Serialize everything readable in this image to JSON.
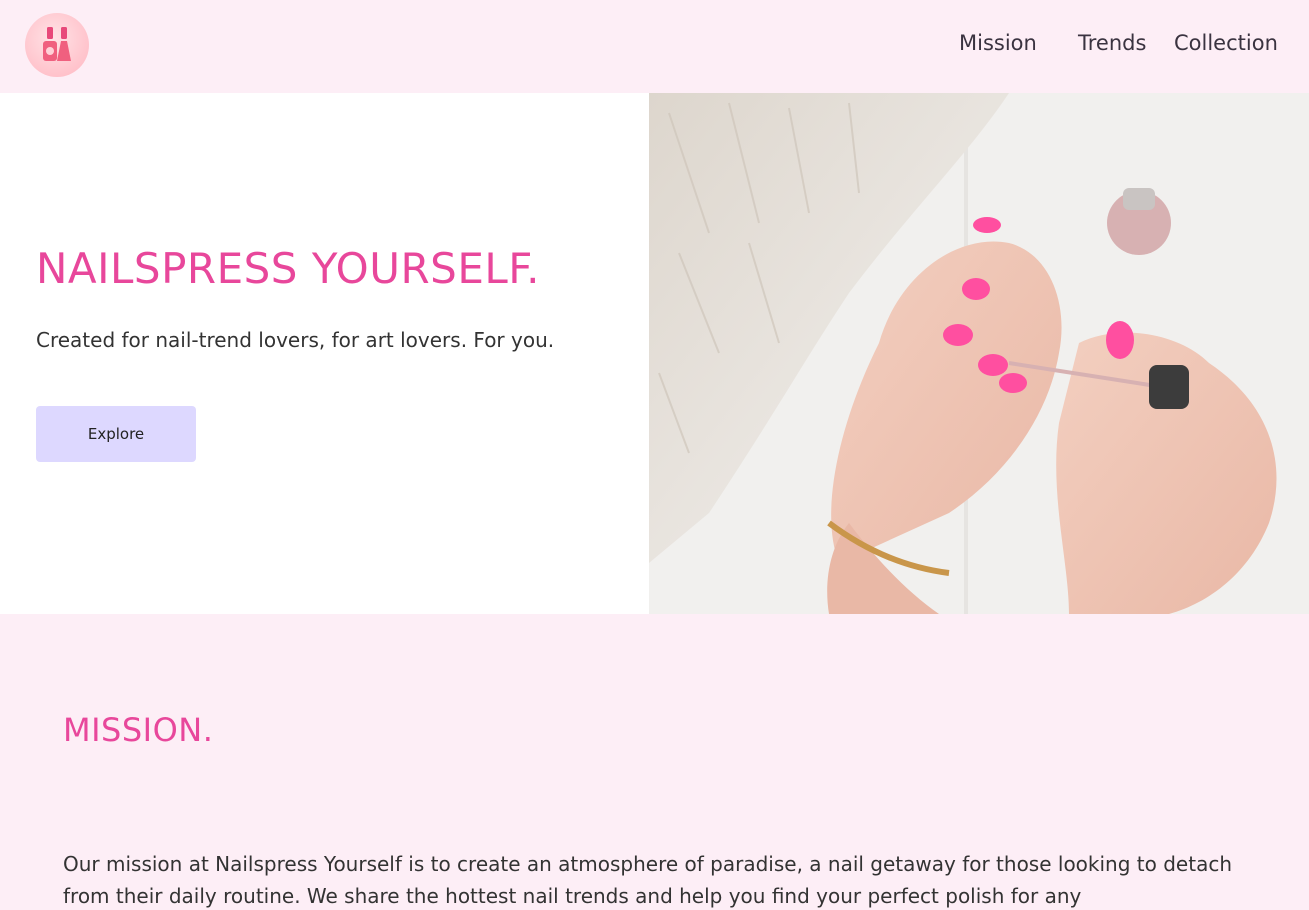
{
  "header": {
    "logo_icon": "nail-polish-icon",
    "nav": [
      {
        "label": "Mission"
      },
      {
        "label": "Trends"
      },
      {
        "label": "Collection"
      }
    ]
  },
  "hero": {
    "title": "NAILSPRESS YOURSELF.",
    "subtitle": "Created for nail-trend lovers, for art lovers. For you.",
    "cta_label": "Explore",
    "image_icon": "hands-painting-nails-photo"
  },
  "mission": {
    "title": "MISSION.",
    "body": "Our mission at Nailspress Yourself is to create an atmosphere of paradise, a nail getaway for those looking to detach from their daily routine. We share the hottest nail trends and help you find your perfect polish for any"
  },
  "colors": {
    "accent_pink": "#e8479b",
    "page_background": "#fdeef6",
    "button_lavender": "#ddd8ff"
  }
}
